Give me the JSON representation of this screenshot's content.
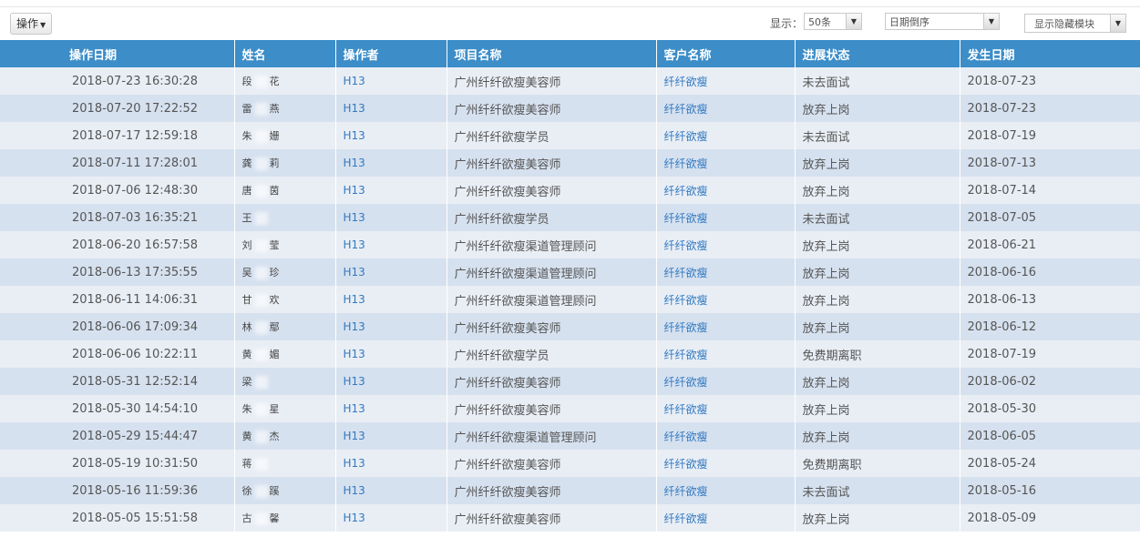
{
  "toolbar": {
    "operation_label": "操作",
    "show_label": "显示：",
    "page_size_value": "50条",
    "order_value": "日期倒序",
    "hide_modules_label": "显示隐藏模块"
  },
  "table": {
    "headers": {
      "op_date": "操作日期",
      "name": "姓名",
      "operator": "操作者",
      "project": "项目名称",
      "client": "客户名称",
      "status": "进展状态",
      "occur_date": "发生日期"
    },
    "rows": [
      {
        "op_date": "2018-07-23 16:30:28",
        "name_first": "段",
        "name_last": "花",
        "operator": "H13",
        "project": "广州纤纤欲瘦美容师",
        "client": "纤纤欲瘦",
        "status": "未去面试",
        "occur_date": "2018-07-23"
      },
      {
        "op_date": "2018-07-20 17:22:52",
        "name_first": "雷",
        "name_last": "燕",
        "operator": "H13",
        "project": "广州纤纤欲瘦美容师",
        "client": "纤纤欲瘦",
        "status": "放弃上岗",
        "occur_date": "2018-07-23"
      },
      {
        "op_date": "2018-07-17 12:59:18",
        "name_first": "朱",
        "name_last": "姗",
        "operator": "H13",
        "project": "广州纤纤欲瘦学员",
        "client": "纤纤欲瘦",
        "status": "未去面试",
        "occur_date": "2018-07-19"
      },
      {
        "op_date": "2018-07-11 17:28:01",
        "name_first": "龚",
        "name_last": "莉",
        "operator": "H13",
        "project": "广州纤纤欲瘦美容师",
        "client": "纤纤欲瘦",
        "status": "放弃上岗",
        "occur_date": "2018-07-13"
      },
      {
        "op_date": "2018-07-06 12:48:30",
        "name_first": "唐",
        "name_last": "茵",
        "operator": "H13",
        "project": "广州纤纤欲瘦美容师",
        "client": "纤纤欲瘦",
        "status": "放弃上岗",
        "occur_date": "2018-07-14"
      },
      {
        "op_date": "2018-07-03 16:35:21",
        "name_first": "王",
        "name_last": "",
        "operator": "H13",
        "project": "广州纤纤欲瘦学员",
        "client": "纤纤欲瘦",
        "status": "未去面试",
        "occur_date": "2018-07-05"
      },
      {
        "op_date": "2018-06-20 16:57:58",
        "name_first": "刘",
        "name_last": "莹",
        "operator": "H13",
        "project": "广州纤纤欲瘦渠道管理顾问",
        "client": "纤纤欲瘦",
        "status": "放弃上岗",
        "occur_date": "2018-06-21"
      },
      {
        "op_date": "2018-06-13 17:35:55",
        "name_first": "吴",
        "name_last": "珍",
        "operator": "H13",
        "project": "广州纤纤欲瘦渠道管理顾问",
        "client": "纤纤欲瘦",
        "status": "放弃上岗",
        "occur_date": "2018-06-16"
      },
      {
        "op_date": "2018-06-11 14:06:31",
        "name_first": "甘",
        "name_last": "欢",
        "operator": "H13",
        "project": "广州纤纤欲瘦渠道管理顾问",
        "client": "纤纤欲瘦",
        "status": "放弃上岗",
        "occur_date": "2018-06-13"
      },
      {
        "op_date": "2018-06-06 17:09:34",
        "name_first": "林",
        "name_last": "鄢",
        "operator": "H13",
        "project": "广州纤纤欲瘦美容师",
        "client": "纤纤欲瘦",
        "status": "放弃上岗",
        "occur_date": "2018-06-12"
      },
      {
        "op_date": "2018-06-06 10:22:11",
        "name_first": "黄",
        "name_last": "媚",
        "operator": "H13",
        "project": "广州纤纤欲瘦学员",
        "client": "纤纤欲瘦",
        "status": "免费期离职",
        "occur_date": "2018-07-19"
      },
      {
        "op_date": "2018-05-31 12:52:14",
        "name_first": "梁",
        "name_last": "",
        "operator": "H13",
        "project": "广州纤纤欲瘦美容师",
        "client": "纤纤欲瘦",
        "status": "放弃上岗",
        "occur_date": "2018-06-02"
      },
      {
        "op_date": "2018-05-30 14:54:10",
        "name_first": "朱",
        "name_last": "星",
        "operator": "H13",
        "project": "广州纤纤欲瘦美容师",
        "client": "纤纤欲瘦",
        "status": "放弃上岗",
        "occur_date": "2018-05-30"
      },
      {
        "op_date": "2018-05-29 15:44:47",
        "name_first": "黄",
        "name_last": "杰",
        "operator": "H13",
        "project": "广州纤纤欲瘦渠道管理顾问",
        "client": "纤纤欲瘦",
        "status": "放弃上岗",
        "occur_date": "2018-06-05"
      },
      {
        "op_date": "2018-05-19 10:31:50",
        "name_first": "蒋",
        "name_last": "",
        "operator": "H13",
        "project": "广州纤纤欲瘦美容师",
        "client": "纤纤欲瘦",
        "status": "免费期离职",
        "occur_date": "2018-05-24"
      },
      {
        "op_date": "2018-05-16 11:59:36",
        "name_first": "徐",
        "name_last": "蹊",
        "operator": "H13",
        "project": "广州纤纤欲瘦美容师",
        "client": "纤纤欲瘦",
        "status": "未去面试",
        "occur_date": "2018-05-16"
      },
      {
        "op_date": "2018-05-05 15:51:58",
        "name_first": "古",
        "name_last": "馨",
        "operator": "H13",
        "project": "广州纤纤欲瘦美容师",
        "client": "纤纤欲瘦",
        "status": "放弃上岗",
        "occur_date": "2018-05-09"
      }
    ]
  },
  "icons": {
    "dropdown_caret": "caret-down-icon"
  }
}
